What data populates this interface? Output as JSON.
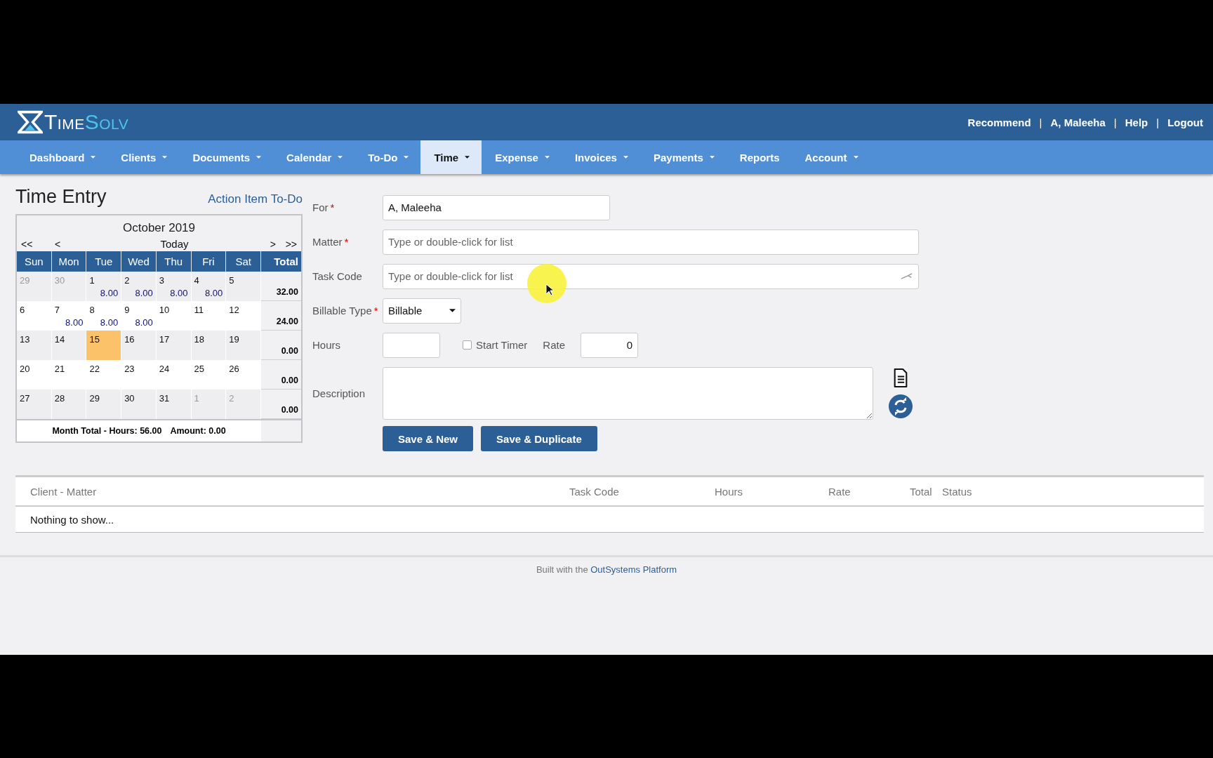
{
  "logo_text": [
    "Time",
    "Solv"
  ],
  "user_links": [
    "Recommend",
    "A, Maleeha",
    "Help",
    "Logout"
  ],
  "user_link_separator": "|",
  "nav": [
    {
      "label": "Dashboard",
      "dropdown": true,
      "selected": false
    },
    {
      "label": "Clients",
      "dropdown": true,
      "selected": false
    },
    {
      "label": "Documents",
      "dropdown": true,
      "selected": false
    },
    {
      "label": "Calendar",
      "dropdown": true,
      "selected": false
    },
    {
      "label": "To-Do",
      "dropdown": true,
      "selected": false
    },
    {
      "label": "Time",
      "dropdown": true,
      "selected": true
    },
    {
      "label": "Expense",
      "dropdown": true,
      "selected": false
    },
    {
      "label": "Invoices",
      "dropdown": true,
      "selected": false
    },
    {
      "label": "Payments",
      "dropdown": true,
      "selected": false
    },
    {
      "label": "Reports",
      "dropdown": false,
      "selected": false
    },
    {
      "label": "Account",
      "dropdown": true,
      "selected": false
    }
  ],
  "page_title": "Time Entry",
  "action_link": "Action Item To-Do",
  "calendar": {
    "month": "October 2019",
    "prev_year": "<<",
    "prev_month": "<",
    "today": "Today",
    "next_month": ">",
    "next_year": ">>",
    "weekdays": [
      "Sun",
      "Mon",
      "Tue",
      "Wed",
      "Thu",
      "Fri",
      "Sat"
    ],
    "total_header": "Total",
    "weeks": [
      {
        "total": "32.00",
        "days": [
          {
            "day": "29",
            "in_month": false,
            "selected": false
          },
          {
            "day": "30",
            "in_month": false,
            "selected": false
          },
          {
            "day": "1",
            "hours": "8.00",
            "in_month": true,
            "selected": false
          },
          {
            "day": "2",
            "hours": "8.00",
            "in_month": true,
            "selected": false
          },
          {
            "day": "3",
            "hours": "8.00",
            "in_month": true,
            "selected": false
          },
          {
            "day": "4",
            "hours": "8.00",
            "in_month": true,
            "selected": false
          },
          {
            "day": "5",
            "in_month": true,
            "selected": false
          }
        ]
      },
      {
        "total": "24.00",
        "days": [
          {
            "day": "6",
            "in_month": true,
            "selected": false
          },
          {
            "day": "7",
            "hours": "8.00",
            "in_month": true,
            "selected": false
          },
          {
            "day": "8",
            "hours": "8.00",
            "in_month": true,
            "selected": false
          },
          {
            "day": "9",
            "hours": "8.00",
            "in_month": true,
            "selected": false
          },
          {
            "day": "10",
            "in_month": true,
            "selected": false
          },
          {
            "day": "11",
            "in_month": true,
            "selected": false
          },
          {
            "day": "12",
            "in_month": true,
            "selected": false
          }
        ]
      },
      {
        "total": "0.00",
        "days": [
          {
            "day": "13",
            "in_month": true,
            "selected": false
          },
          {
            "day": "14",
            "in_month": true,
            "selected": false
          },
          {
            "day": "15",
            "in_month": true,
            "selected": true
          },
          {
            "day": "16",
            "in_month": true,
            "selected": false
          },
          {
            "day": "17",
            "in_month": true,
            "selected": false
          },
          {
            "day": "18",
            "in_month": true,
            "selected": false
          },
          {
            "day": "19",
            "in_month": true,
            "selected": false
          }
        ]
      },
      {
        "total": "0.00",
        "days": [
          {
            "day": "20",
            "in_month": true,
            "selected": false
          },
          {
            "day": "21",
            "in_month": true,
            "selected": false
          },
          {
            "day": "22",
            "in_month": true,
            "selected": false
          },
          {
            "day": "23",
            "in_month": true,
            "selected": false
          },
          {
            "day": "24",
            "in_month": true,
            "selected": false
          },
          {
            "day": "25",
            "in_month": true,
            "selected": false
          },
          {
            "day": "26",
            "in_month": true,
            "selected": false
          }
        ]
      },
      {
        "total": "0.00",
        "days": [
          {
            "day": "27",
            "in_month": true,
            "selected": false
          },
          {
            "day": "28",
            "in_month": true,
            "selected": false
          },
          {
            "day": "29",
            "in_month": true,
            "selected": false
          },
          {
            "day": "30",
            "in_month": true,
            "selected": false
          },
          {
            "day": "31",
            "in_month": true,
            "selected": false
          },
          {
            "day": "1",
            "in_month": false,
            "selected": false
          },
          {
            "day": "2",
            "in_month": false,
            "selected": false
          }
        ]
      }
    ],
    "month_total": [
      "Month Total - Hours: 56.00",
      "Amount: 0.00"
    ]
  },
  "required_mark": "*",
  "form": {
    "for": {
      "label": "For",
      "required": true,
      "value": "A, Maleeha"
    },
    "matter": {
      "label": "Matter",
      "required": true,
      "placeholder": "Type or double-click for list"
    },
    "task_code": {
      "label": "Task Code",
      "required": false,
      "placeholder": "Type or double-click for list"
    },
    "billable_type": {
      "label": "Billable Type",
      "required": true,
      "value": "Billable"
    },
    "hours": {
      "label": "Hours"
    },
    "start_timer": {
      "label": "Start Timer",
      "checked": false
    },
    "rate": {
      "label": "Rate",
      "value": "0"
    },
    "description": {
      "label": "Description"
    },
    "buttons": [
      "Save & New",
      "Save & Duplicate"
    ]
  },
  "table": {
    "columns": [
      "Client - Matter",
      "Task Code",
      "Hours",
      "Rate",
      "Total",
      "Status"
    ],
    "empty_message": "Nothing to show..."
  },
  "footer": {
    "text": "Built with the",
    "link": "OutSystems Platform"
  }
}
